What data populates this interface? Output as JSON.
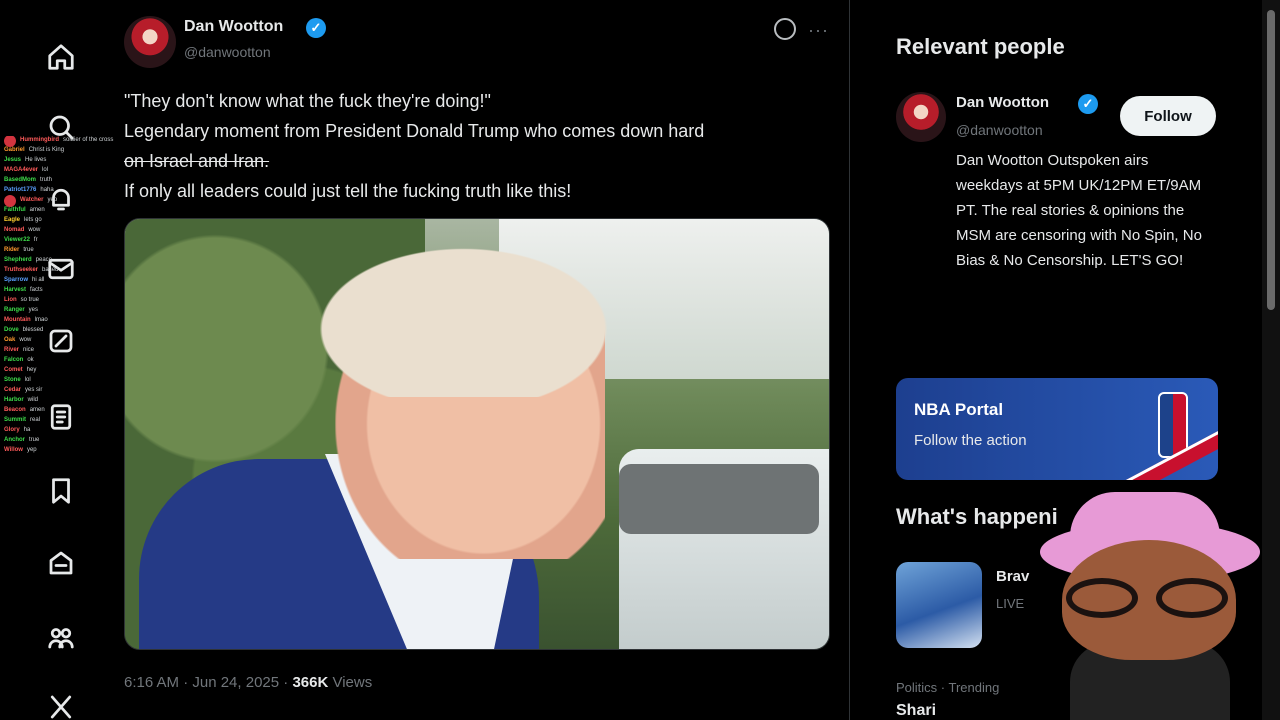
{
  "post": {
    "author_name": "Dan Wootton",
    "author_handle": "@danwootton",
    "verified_glyph": "✓",
    "lines": [
      "\"They don't know what the fuck they're doing!\"",
      "Legendary moment from President Donald Trump who comes down hard",
      "on Israel and Iran.",
      "If only all leaders could just tell the fucking truth like this!"
    ],
    "timestamp": "6:16 AM · Jun 24, 2025",
    "views_count": "366K",
    "views_label": "Views",
    "more_glyph": "···"
  },
  "sidebar": {
    "relevant_title": "Relevant people",
    "person": {
      "name": "Dan Wootton",
      "handle": "@danwootton",
      "follow_label": "Follow",
      "bio": "Dan Wootton Outspoken airs weekdays at 5PM UK/12PM ET/9AM PT. The real stories & opinions the MSM are censoring with No Spin, No Bias & No Censorship. LET'S GO!"
    },
    "promo": {
      "title": "NBA Portal",
      "subtitle": "Follow the action"
    },
    "whats_title": "What's happeni",
    "trend": {
      "name": "Brav",
      "status": "LIVE",
      "category": "Politics · Trending",
      "topic": "Shari"
    }
  },
  "chat": [
    {
      "user": "Hummingbird",
      "msg": "soldier of the cross",
      "color": "#ff5a5a"
    },
    {
      "user": "Gabriel",
      "msg": "Christ is King",
      "color": "#ff9b2f"
    },
    {
      "user": "Jesus",
      "msg": "He lives",
      "color": "#3ddc4a"
    },
    {
      "user": "MAGA4ever",
      "msg": "lol",
      "color": "#ff5a5a"
    },
    {
      "user": "BasedMom",
      "msg": "truth",
      "color": "#3ddc4a"
    },
    {
      "user": "Patriot1776",
      "msg": "haha",
      "color": "#5aa0ff"
    },
    {
      "user": "Watcher",
      "msg": "yep",
      "color": "#ff5a5a"
    },
    {
      "user": "Faithful",
      "msg": "amen",
      "color": "#3ddc4a"
    },
    {
      "user": "Eagle",
      "msg": "lets go",
      "color": "#ffd02f"
    },
    {
      "user": "Nomad",
      "msg": "wow",
      "color": "#ff5a5a"
    },
    {
      "user": "Viewer22",
      "msg": "fr",
      "color": "#3ddc4a"
    },
    {
      "user": "Rider",
      "msg": "true",
      "color": "#ff9b2f"
    },
    {
      "user": "Shepherd",
      "msg": "peace",
      "color": "#3ddc4a"
    },
    {
      "user": "Truthseeker",
      "msg": "based",
      "color": "#ff5a5a"
    },
    {
      "user": "Sparrow",
      "msg": "hi all",
      "color": "#5aa0ff"
    },
    {
      "user": "Harvest",
      "msg": "facts",
      "color": "#3ddc4a"
    },
    {
      "user": "Lion",
      "msg": "so true",
      "color": "#ff5a5a"
    },
    {
      "user": "Ranger",
      "msg": "yes",
      "color": "#3ddc4a"
    },
    {
      "user": "Mountain",
      "msg": "lmao",
      "color": "#ff5a5a"
    },
    {
      "user": "Dove",
      "msg": "blessed",
      "color": "#3ddc4a"
    },
    {
      "user": "Oak",
      "msg": "wow",
      "color": "#ff9b2f"
    },
    {
      "user": "River",
      "msg": "nice",
      "color": "#ff5a5a"
    },
    {
      "user": "Falcon",
      "msg": "ok",
      "color": "#3ddc4a"
    },
    {
      "user": "Comet",
      "msg": "hey",
      "color": "#ff5a5a"
    },
    {
      "user": "Stone",
      "msg": "lol",
      "color": "#3ddc4a"
    },
    {
      "user": "Cedar",
      "msg": "yes sir",
      "color": "#ff5a5a"
    },
    {
      "user": "Harbor",
      "msg": "wild",
      "color": "#3ddc4a"
    },
    {
      "user": "Beacon",
      "msg": "amen",
      "color": "#ff5a5a"
    },
    {
      "user": "Summit",
      "msg": "real",
      "color": "#3ddc4a"
    },
    {
      "user": "Glory",
      "msg": "ha",
      "color": "#ff5a5a"
    },
    {
      "user": "Anchor",
      "msg": "true",
      "color": "#3ddc4a"
    },
    {
      "user": "Willow",
      "msg": "yep",
      "color": "#ff5a5a"
    }
  ],
  "colors": {
    "accent": "#1d9bf0",
    "background": "#000000",
    "text_primary": "#e7e9ea",
    "text_secondary": "#71767b",
    "promo_bg": "#2a5ab8"
  },
  "icons": {
    "nav": [
      "home-icon",
      "search-icon",
      "notifications-icon",
      "messages-icon",
      "grok-icon",
      "lists-icon",
      "bookmarks-icon",
      "communities-icon",
      "premium-icon",
      "profile-icon",
      "x-icon"
    ]
  }
}
